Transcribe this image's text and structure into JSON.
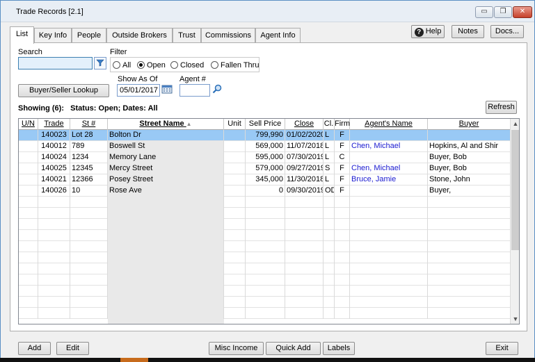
{
  "window": {
    "title": "Trade Records [2.1]",
    "minimize_glyph": "▭",
    "restore_glyph": "❐",
    "close_glyph": "✕"
  },
  "tabs": [
    "List",
    "Key Info",
    "People",
    "Outside Brokers",
    "Trust",
    "Commissions",
    "Agent Info"
  ],
  "top_buttons": {
    "help": "Help",
    "notes": "Notes",
    "docs": "Docs..."
  },
  "search": {
    "label": "Search",
    "value": ""
  },
  "filter": {
    "label": "Filter",
    "options": [
      "All",
      "Open",
      "Closed",
      "Fallen Thru"
    ],
    "selected": "Open"
  },
  "show_as_of": {
    "label": "Show As Of",
    "value": "05/01/2017"
  },
  "agent_no": {
    "label": "Agent #",
    "value": ""
  },
  "lookup_button": "Buyer/Seller Lookup",
  "status_text": "Showing (6):   Status: Open; Dates: All",
  "refresh_button": "Refresh",
  "grid": {
    "columns": [
      "U/N",
      "Trade",
      "St #",
      "Street Name",
      "Unit",
      "Sell Price",
      "Close",
      "Cl.",
      "Firm",
      "Agent's Name",
      "Buyer"
    ],
    "sort_indicator": "▲",
    "rows": [
      [
        "",
        "140023",
        "Lot 28",
        "Bolton Dr",
        "",
        "799,990",
        "01/02/2020",
        "L",
        "F",
        "",
        ""
      ],
      [
        "",
        "140012",
        "789",
        "Boswell St",
        "",
        "569,000",
        "11/07/2018",
        "L",
        "F",
        "Chen, Michael",
        "Hopkins, Al and Shir"
      ],
      [
        "",
        "140024",
        "1234",
        "Memory Lane",
        "",
        "595,000",
        "07/30/2019",
        "L",
        "C",
        "",
        "Buyer, Bob"
      ],
      [
        "",
        "140025",
        "12345",
        "Mercy Street",
        "",
        "579,000",
        "09/27/2019",
        "S",
        "F",
        "Chen, Michael",
        "Buyer, Bob"
      ],
      [
        "",
        "140021",
        "12366",
        "Posey Street",
        "",
        "345,000",
        "11/30/2018",
        "L",
        "F",
        "Bruce, Jamie",
        "Stone, John"
      ],
      [
        "",
        "140026",
        "10",
        "Rose Ave",
        "",
        "0",
        "09/30/2019",
        "OD",
        "F",
        "",
        "Buyer,"
      ]
    ],
    "selected_row": 0
  },
  "bottom_buttons": {
    "add": "Add",
    "edit": "Edit",
    "misc_income": "Misc Income",
    "quick_add": "Quick Add",
    "labels": "Labels",
    "exit": "Exit"
  }
}
